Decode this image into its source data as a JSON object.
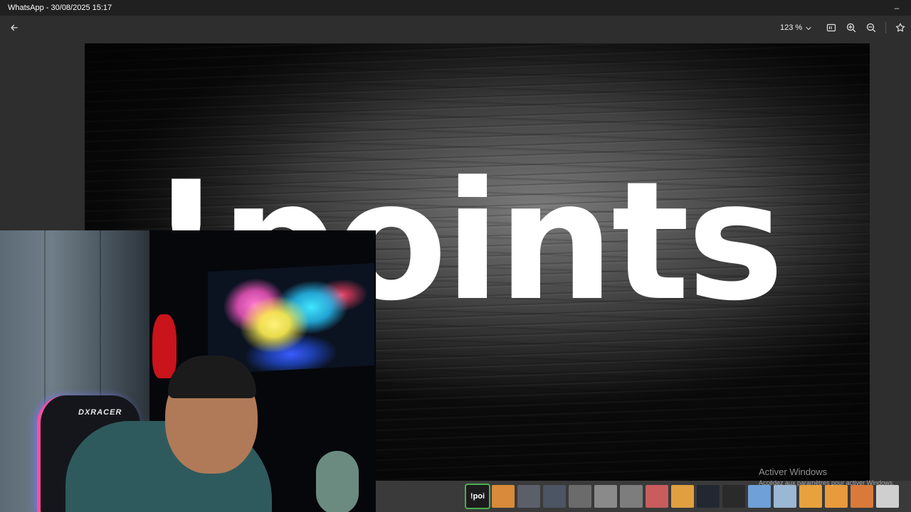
{
  "window": {
    "title": "WhatsApp - 30/08/2025 15:17",
    "minimize_glyph": "–"
  },
  "toolbar": {
    "back_icon": "arrow-left-icon",
    "zoom_level": "123 %",
    "zoom_dropdown_icon": "chevron-down-icon",
    "fit_icon": "fit-to-window-icon",
    "zoom_in_icon": "zoom-in-icon",
    "zoom_out_icon": "zoom-out-icon",
    "favorite_icon": "star-icon"
  },
  "image": {
    "text": "!points"
  },
  "webcam": {
    "chair_logo": "DXRACER"
  },
  "filmstrip": {
    "thumbnails": [
      {
        "label": "!poi",
        "selected": true,
        "color": "#1c1c1c"
      },
      {
        "label": "",
        "selected": false,
        "color": "#d98a3a"
      },
      {
        "label": "",
        "selected": false,
        "color": "#5a5f6a"
      },
      {
        "label": "",
        "selected": false,
        "color": "#4b5563"
      },
      {
        "label": "",
        "selected": false,
        "color": "#6b6b6b"
      },
      {
        "label": "",
        "selected": false,
        "color": "#8a8a8a"
      },
      {
        "label": "",
        "selected": false,
        "color": "#7d7d7d"
      },
      {
        "label": "",
        "selected": false,
        "color": "#c95c5c"
      },
      {
        "label": "",
        "selected": false,
        "color": "#e0a040"
      },
      {
        "label": "",
        "selected": false,
        "color": "#222831"
      },
      {
        "label": "",
        "selected": false,
        "color": "#2a2a2a"
      },
      {
        "label": "",
        "selected": false,
        "color": "#6fa0d8"
      },
      {
        "label": "",
        "selected": false,
        "color": "#9bb7d4"
      },
      {
        "label": "",
        "selected": false,
        "color": "#e8a13c"
      },
      {
        "label": "",
        "selected": false,
        "color": "#e89a3c"
      },
      {
        "label": "",
        "selected": false,
        "color": "#d97a3a"
      },
      {
        "label": "",
        "selected": false,
        "color": "#cfcfcf"
      }
    ]
  },
  "watermark": {
    "title": "Activer Windows",
    "subtitle": "Accédez aux paramètres pour activer Windows."
  },
  "colors": {
    "accent_selected": "#4caf50",
    "titlebar_bg": "#202020",
    "toolbar_bg": "#2e2e2e"
  }
}
